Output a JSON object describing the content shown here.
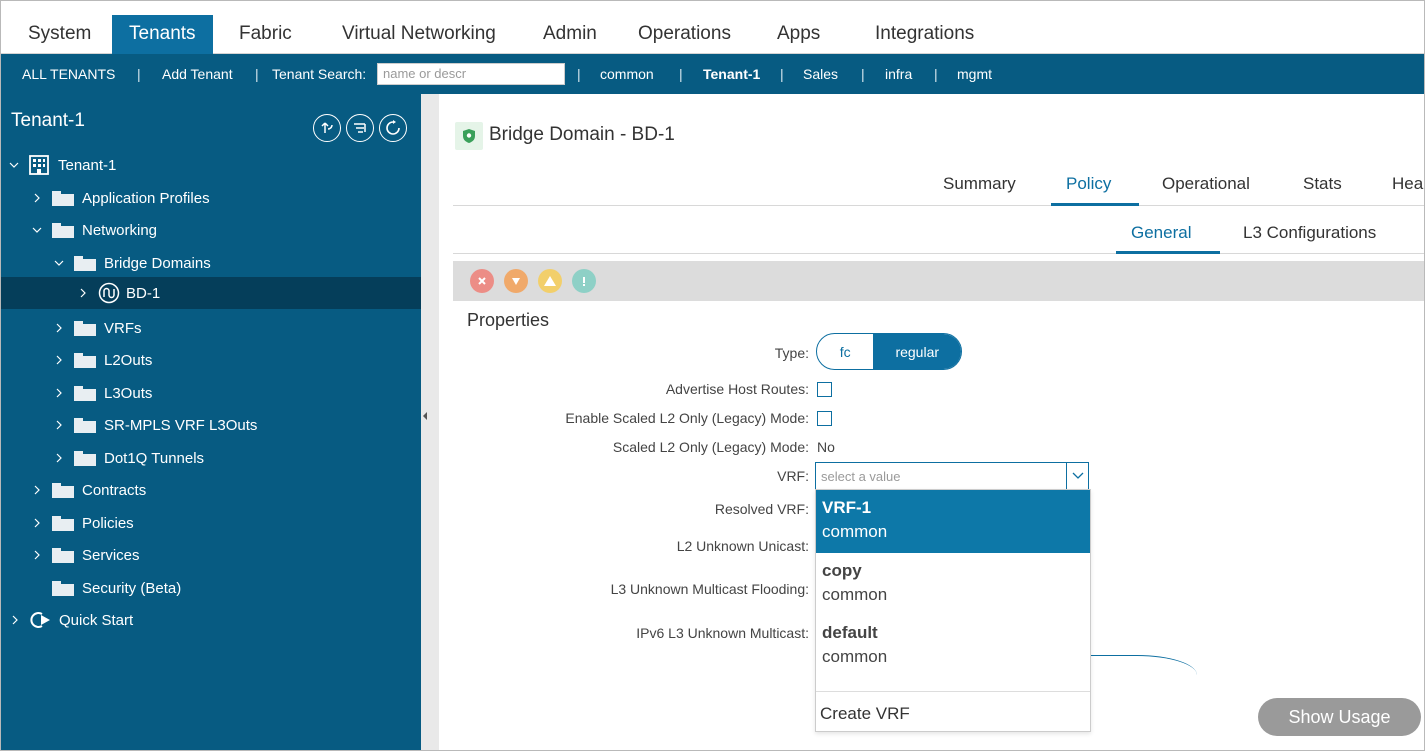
{
  "topnav": {
    "tabs": [
      {
        "label": "System"
      },
      {
        "label": "Tenants"
      },
      {
        "label": "Fabric"
      },
      {
        "label": "Virtual Networking"
      },
      {
        "label": "Admin"
      },
      {
        "label": "Operations"
      },
      {
        "label": "Apps"
      },
      {
        "label": "Integrations"
      }
    ],
    "active": "Tenants"
  },
  "subnav": {
    "all_tenants": "ALL TENANTS",
    "add_tenant": "Add Tenant",
    "tenant_search_label": "Tenant Search:",
    "search_placeholder": "name or descr",
    "tenants": [
      "common",
      "Tenant-1",
      "Sales",
      "infra",
      "mgmt"
    ],
    "separator": "|"
  },
  "leftpane": {
    "title": "Tenant-1",
    "tree": {
      "root": "Tenant-1",
      "application_profiles": "Application Profiles",
      "networking": "Networking",
      "bridge_domains": "Bridge Domains",
      "bd1": "BD-1",
      "vrfs": "VRFs",
      "l2outs": "L2Outs",
      "l3outs": "L3Outs",
      "srmpls": "SR-MPLS VRF L3Outs",
      "dot1q": "Dot1Q Tunnels",
      "contracts": "Contracts",
      "policies": "Policies",
      "services": "Services",
      "security": "Security (Beta)",
      "quickstart": "Quick Start"
    }
  },
  "content": {
    "title": "Bridge Domain - BD-1",
    "tabs": [
      "Summary",
      "Policy",
      "Operational",
      "Stats",
      "Hea"
    ],
    "active_tab": "Policy",
    "subtabs": [
      "General",
      "L3 Configurations"
    ],
    "active_subtab": "General",
    "properties_title": "Properties",
    "labels": {
      "type": "Type:",
      "advertise": "Advertise Host Routes:",
      "enable_scaled": "Enable Scaled L2 Only (Legacy) Mode:",
      "scaled": "Scaled L2 Only (Legacy) Mode:",
      "vrf": "VRF:",
      "resolved_vrf": "Resolved VRF:",
      "l2_unknown": "L2 Unknown Unicast:",
      "l3_unknown": "L3 Unknown Multicast Flooding:",
      "ipv6_l3": "IPv6 L3 Unknown Multicast:"
    },
    "type_options": [
      "fc",
      "regular"
    ],
    "type_selected": "regular",
    "scaled_value": "No",
    "vrf_placeholder": "select a value",
    "vrf_options": [
      {
        "name": "VRF-1",
        "tenant": "common"
      },
      {
        "name": "copy",
        "tenant": "common"
      },
      {
        "name": "default",
        "tenant": "common"
      }
    ],
    "create_vrf": "Create VRF",
    "show_usage": "Show Usage"
  },
  "colors": {
    "brand": "#075b82",
    "accent": "#0d6fa1",
    "selected_option": "#0d78a8"
  }
}
